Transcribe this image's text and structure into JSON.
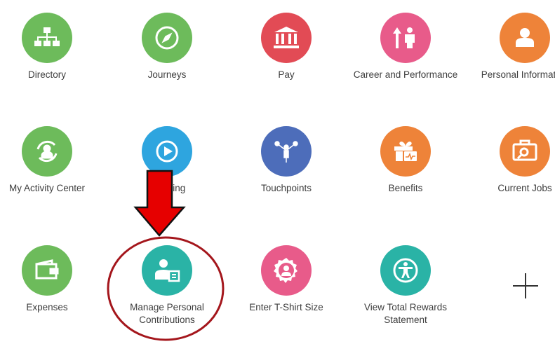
{
  "colors": {
    "green": "#6dbb5b",
    "red": "#e24b55",
    "pink": "#e85b8a",
    "orange": "#ee8339",
    "blue": "#2ea5df",
    "indigo": "#4d6dba",
    "teal": "#2ab3a6",
    "annotation_arrow": "#e60000",
    "annotation_circle": "#a4161c"
  },
  "tiles": [
    {
      "label": "Directory",
      "icon": "org-chart-icon",
      "color": "green"
    },
    {
      "label": "Journeys",
      "icon": "compass-icon",
      "color": "green"
    },
    {
      "label": "Pay",
      "icon": "bank-icon",
      "color": "red"
    },
    {
      "label": "Career and Performance",
      "icon": "career-growth-icon",
      "color": "pink"
    },
    {
      "label": "Personal Information",
      "icon": "person-card-icon",
      "color": "orange"
    },
    {
      "label": "My Activity Center",
      "icon": "activity-person-icon",
      "color": "green"
    },
    {
      "label": "Learning",
      "icon": "play-icon",
      "color": "blue"
    },
    {
      "label": "Touchpoints",
      "icon": "network-icon",
      "color": "indigo"
    },
    {
      "label": "Benefits",
      "icon": "gift-icon",
      "color": "orange"
    },
    {
      "label": "Current Jobs",
      "icon": "briefcase-search-icon",
      "color": "orange"
    },
    {
      "label": "Expenses",
      "icon": "wallet-icon",
      "color": "green"
    },
    {
      "label": "Manage Personal Contributions",
      "icon": "person-document-icon",
      "color": "teal"
    },
    {
      "label": "Enter T-Shirt Size",
      "icon": "badge-person-icon",
      "color": "pink"
    },
    {
      "label": "View Total Rewards Statement",
      "icon": "accessibility-icon",
      "color": "teal"
    }
  ],
  "add_button": {
    "icon": "plus-icon"
  },
  "annotation": {
    "arrow_icon": "down-arrow-icon",
    "highlight": "highlight-circle"
  }
}
